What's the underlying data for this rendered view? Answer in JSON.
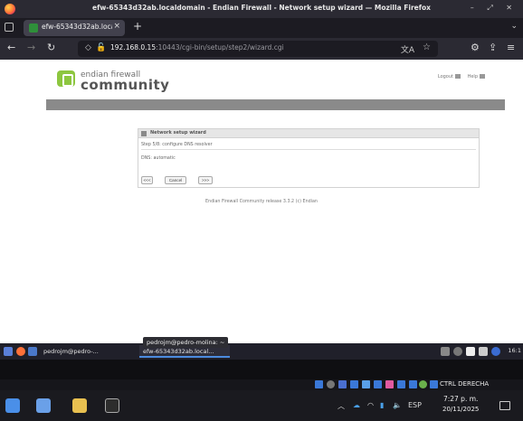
{
  "window": {
    "title": "efw-65343d32ab.localdomain - Endian Firewall - Network setup wizard — Mozilla Firefox",
    "controls": "– ⤢ ✕"
  },
  "tab": {
    "label": "efw-65343d32ab.localdo",
    "close": "×",
    "new_tab": "+",
    "list_all": "⌄"
  },
  "nav": {
    "back": "←",
    "forward": "→",
    "reload": "↻",
    "url_host": "192.168.0.15",
    "url_rest": ":10443/cgi-bin/setup/step2/wizard.cgi",
    "translate": "文A",
    "bookmark": "☆",
    "extensions": "⚙",
    "share": "⇪",
    "menu": "≡"
  },
  "brand": {
    "line1": "endian firewall",
    "line2": "community"
  },
  "toplinks": {
    "logout": "Logout",
    "help": "Help"
  },
  "wizard": {
    "header": "Network setup wizard",
    "step": "Step 5/8: configure DNS resolver",
    "dns": "DNS: automatic",
    "prev": "<<<",
    "cancel": "Cancel",
    "next": ">>>"
  },
  "footer": "Endian Firewall Community release 3.3.2 (c) Endian",
  "panel": {
    "task1": "pedrojm@pedro-...",
    "task2": "efw-65343d32ab.local...",
    "tooltip": "pedrojm@pedro-molina: ~",
    "clock_right": "16:1"
  },
  "systray": {
    "ctrl": "CTRL DERECHA"
  },
  "taskbar": {
    "lang": "ESP",
    "time": "7:27 p. m.",
    "date": "20/11/2025"
  },
  "colors": {
    "brand_green": "#8dc63f",
    "band_gray": "#8a8a8a",
    "firefox_chrome": "#2b2a33"
  }
}
